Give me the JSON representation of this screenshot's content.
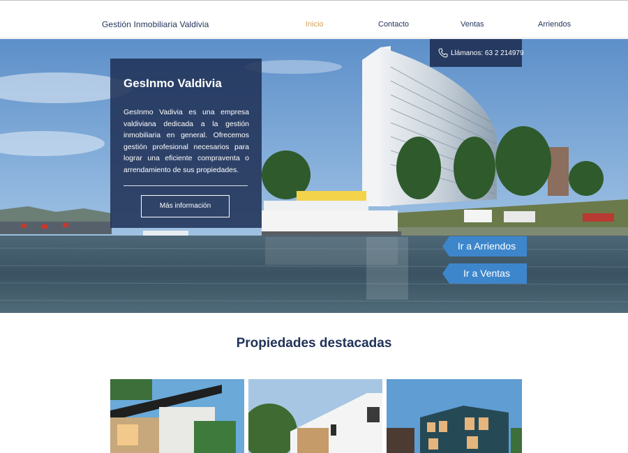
{
  "header": {
    "brand": "Gestión Inmobiliaria Valdivia",
    "nav": [
      "Inicio",
      "Contacto",
      "Ventas",
      "Arriendos"
    ],
    "active_index": 0
  },
  "hero": {
    "phone_label": "Llámanos: 63 2 214979",
    "title": "GesInmo Valdivia",
    "description": "GesInmo Vadivia es una empresa valdiviana dedicada a la gestión inmobiliaria en general. Ofrecemos gestión profesional necesarios para lograr una eficiente compraventa o arrendamiento de sus propiedades.",
    "more_button": "Más información",
    "arriendos_button": "Ir a Arriendos",
    "ventas_button": "Ir a Ventas"
  },
  "featured": {
    "title": "Propiedades destacadas"
  },
  "colors": {
    "navy": "#213258",
    "accent_gold": "#d7a25a",
    "ribbon_blue": "#3d86cc"
  },
  "icons": {
    "phone": "phone-icon"
  }
}
